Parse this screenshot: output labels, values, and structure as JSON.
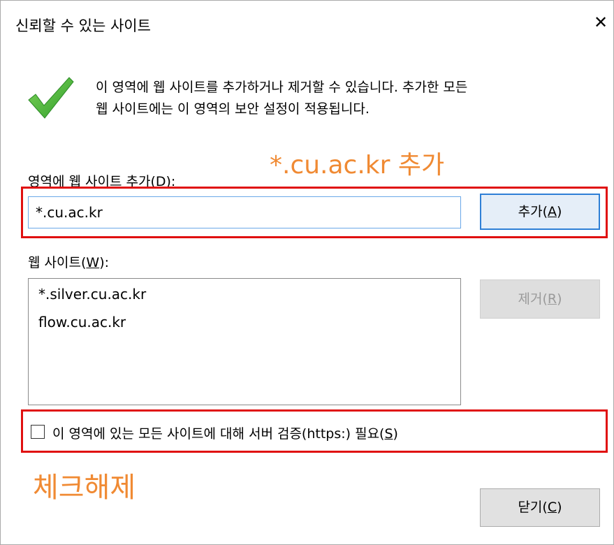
{
  "dialog": {
    "title": "신뢰할 수 있는 사이트",
    "close_glyph": "✕"
  },
  "info": {
    "icon": "green-checkmark-icon",
    "line1": "이 영역에 웹 사이트를 추가하거나 제거할 수 있습니다. 추가한 모든",
    "line2": "웹 사이트에는 이 영역의 보안 설정이 적용됩니다."
  },
  "add_section": {
    "label": "영역에 웹 사이트 추가",
    "label_key": "D",
    "label_close": "):",
    "input_value": "*.cu.ac.kr",
    "add_button": "추가",
    "add_key": "A"
  },
  "sites_section": {
    "label": "웹 사이트",
    "label_key": "W",
    "label_close": "):",
    "items": [
      "*.silver.cu.ac.kr",
      "flow.cu.ac.kr"
    ],
    "remove_button": "제거",
    "remove_key": "R"
  },
  "https_option": {
    "checked": false,
    "label": "이 영역에 있는 모든 사이트에 대해 서버 검증(https:) 필요",
    "key": "S"
  },
  "footer": {
    "close_button": "닫기",
    "close_key": "C"
  },
  "annotations": {
    "add_note": "*.cu.ac.kr 추가",
    "uncheck_note": "체크해제",
    "note_color": "#f08a33",
    "highlight_color": "#e01010"
  }
}
